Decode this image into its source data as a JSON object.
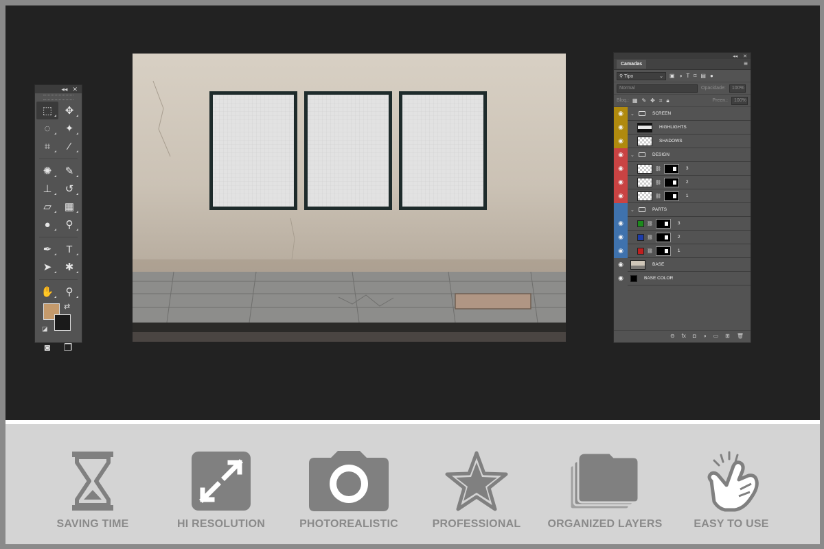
{
  "theme": {
    "stage_bg": "#222222",
    "frame_bg": "#8a8a8a",
    "features_bg": "#d4d4d4",
    "icon_color": "#808080",
    "fg_swatch": "#c49a6c",
    "bg_swatch": "#1a1a1a"
  },
  "toolbox": {
    "collapse_label": "◂◂",
    "close_label": "✕",
    "tools": [
      {
        "name": "rect-marquee-tool",
        "glyph": "⬚"
      },
      {
        "name": "move-tool",
        "glyph": "✥"
      },
      {
        "name": "lasso-tool",
        "glyph": "◌"
      },
      {
        "name": "magic-wand-tool",
        "glyph": "✦"
      },
      {
        "name": "crop-tool",
        "glyph": "⌗"
      },
      {
        "name": "eyedropper-tool",
        "glyph": "⁄"
      },
      {
        "name": "healing-brush-tool",
        "glyph": "✺"
      },
      {
        "name": "brush-tool",
        "glyph": "✎"
      },
      {
        "name": "clone-stamp-tool",
        "glyph": "⊥"
      },
      {
        "name": "history-brush-tool",
        "glyph": "↺"
      },
      {
        "name": "eraser-tool",
        "glyph": "▱"
      },
      {
        "name": "gradient-tool",
        "glyph": "▦"
      },
      {
        "name": "blur-tool",
        "glyph": "●"
      },
      {
        "name": "dodge-tool",
        "glyph": "⚲"
      },
      {
        "name": "pen-tool",
        "glyph": "✒"
      },
      {
        "name": "type-tool",
        "glyph": "T"
      },
      {
        "name": "path-select-tool",
        "glyph": "➤"
      },
      {
        "name": "custom-shape-tool",
        "glyph": "✱"
      },
      {
        "name": "hand-tool",
        "glyph": "✋"
      },
      {
        "name": "zoom-tool",
        "glyph": "⚲"
      }
    ],
    "quick_mask_glyph": "◙",
    "screen_mode_glyph": "❐"
  },
  "layers_panel": {
    "tab_label": "Camadas",
    "menu_glyph": "≡",
    "filter_label": "Tipo",
    "blend_mode": "Normal",
    "opacity_label": "Opacidade:",
    "opacity_value": "100%",
    "lock_label": "Bloq.:",
    "fill_label": "Preen.:",
    "fill_value": "100%",
    "layers": [
      {
        "type": "group",
        "name": "SCREEN",
        "color": "#b08a0e",
        "indent": 0
      },
      {
        "type": "layer",
        "name": "HIGHLIGHTS",
        "color": "#b08a0e",
        "indent": 1,
        "thumb": "check-dark"
      },
      {
        "type": "layer",
        "name": "SHADOWS",
        "color": "#b08a0e",
        "indent": 1,
        "thumb": "check"
      },
      {
        "type": "group",
        "name": "DESIGN",
        "color": "#c94343",
        "indent": 0
      },
      {
        "type": "smart",
        "name": "3",
        "color": "#c94343",
        "indent": 1
      },
      {
        "type": "smart",
        "name": "2",
        "color": "#c94343",
        "indent": 1
      },
      {
        "type": "smart",
        "name": "1",
        "color": "#c94343",
        "indent": 1
      },
      {
        "type": "group",
        "name": "PARTS",
        "color": "#3f72ad",
        "indent": 0,
        "hidden": true
      },
      {
        "type": "solid",
        "name": "3",
        "color": "#3f72ad",
        "indent": 1,
        "fill": "#1d8a1d"
      },
      {
        "type": "solid",
        "name": "2",
        "color": "#3f72ad",
        "indent": 1,
        "fill": "#1d3ca8"
      },
      {
        "type": "solid",
        "name": "1",
        "color": "#3f72ad",
        "indent": 1,
        "fill": "#c01f1f"
      },
      {
        "type": "base",
        "name": "BASE",
        "color": "#535353",
        "indent": 0
      },
      {
        "type": "solid",
        "name": "BASE COLOR",
        "color": "#535353",
        "indent": 0,
        "fill": "#000000"
      }
    ]
  },
  "features": [
    {
      "label": "SAVING TIME",
      "icon": "hourglass-icon"
    },
    {
      "label": "HI RESOLUTION",
      "icon": "expand-arrows-icon"
    },
    {
      "label": "PHOTOREALISTIC",
      "icon": "camera-icon"
    },
    {
      "label": "PROFESSIONAL",
      "icon": "star-icon"
    },
    {
      "label": "ORGANIZED LAYERS",
      "icon": "layers-stack-icon"
    },
    {
      "label": "EASY TO USE",
      "icon": "tap-hand-icon"
    }
  ]
}
